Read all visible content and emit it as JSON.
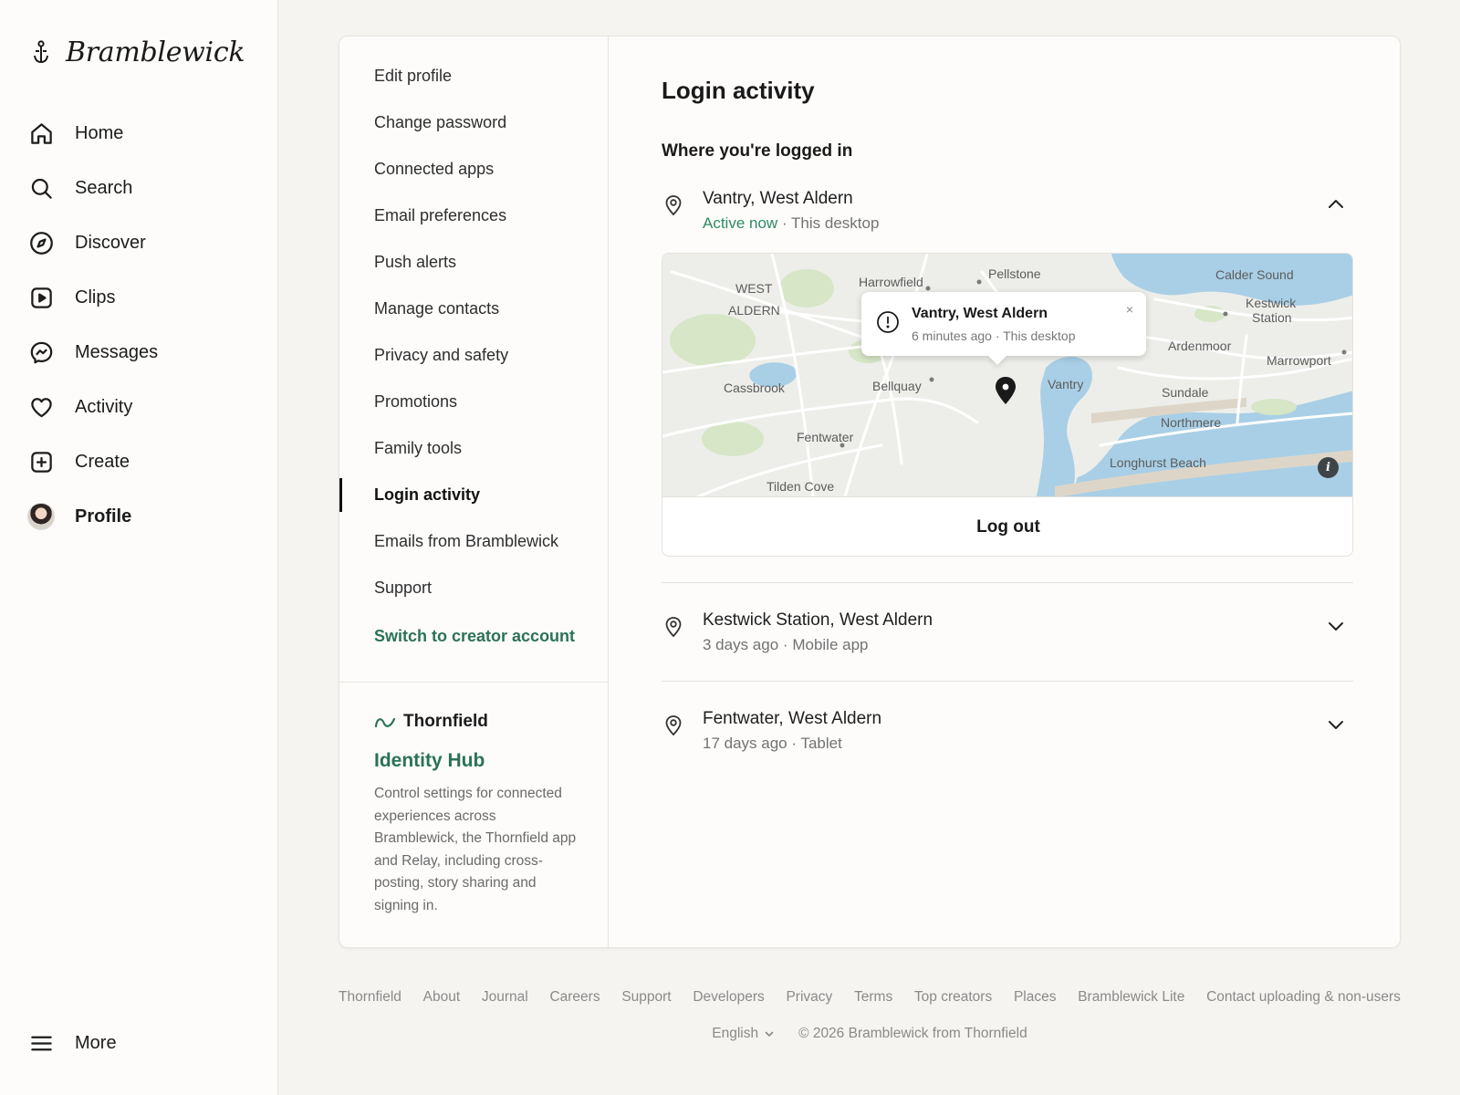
{
  "brand": {
    "name": "Bramblewick",
    "logo_icon": "anchor-icon"
  },
  "nav": {
    "items": [
      {
        "label": "Home",
        "icon": "home-icon"
      },
      {
        "label": "Search",
        "icon": "search-icon"
      },
      {
        "label": "Discover",
        "icon": "compass-icon"
      },
      {
        "label": "Clips",
        "icon": "play-icon"
      },
      {
        "label": "Messages",
        "icon": "messenger-icon"
      },
      {
        "label": "Activity",
        "icon": "heart-icon"
      },
      {
        "label": "Create",
        "icon": "plus-square-icon"
      },
      {
        "label": "Profile",
        "icon": "avatar"
      }
    ],
    "more_label": "More"
  },
  "settings": {
    "items": [
      "Edit profile",
      "Change password",
      "Connected apps",
      "Email preferences",
      "Push alerts",
      "Manage contacts",
      "Privacy and safety",
      "Promotions",
      "Family tools",
      "Login activity",
      "Emails from Bramblewick",
      "Support"
    ],
    "active": "Login activity",
    "creator_link": "Switch to creator account"
  },
  "hub": {
    "brand": "Thornfield",
    "title": "Identity Hub",
    "description": "Control settings for connected experiences across Bramblewick, the Thornfield app and Relay, including cross-posting, story sharing and signing in."
  },
  "login_activity": {
    "title": "Login activity",
    "subtitle": "Where you're logged in",
    "sessions": [
      {
        "location": "Vantry, West Aldern",
        "status": "Active now",
        "separator": "·",
        "device": "This desktop",
        "expanded": true
      },
      {
        "location": "Kestwick Station, West Aldern",
        "time": "3 days ago",
        "separator": "·",
        "device": "Mobile app",
        "expanded": false
      },
      {
        "location": "Fentwater, West Aldern",
        "time": "17 days ago",
        "separator": "·",
        "device": "Tablet",
        "expanded": false
      }
    ],
    "map": {
      "popup_title": "Vantry, West Aldern",
      "popup_meta": "6 minutes ago · This desktop",
      "close_glyph": "×",
      "info_glyph": "i",
      "labels": {
        "west": "WEST",
        "aldern": "ALDERN",
        "harrowfield": "Harrowfield",
        "pellstone": "Pellstone",
        "calder_sound": "Calder Sound",
        "kestwick": "Kestwick",
        "station": "Station",
        "ardenmoor": "Ardenmoor",
        "marrowport": "Marrowport",
        "cassbrook": "Cassbrook",
        "bellquay": "Bellquay",
        "vantry": "Vantry",
        "sundale": "Sundale",
        "northmere": "Northmere",
        "fentwater": "Fentwater",
        "longhurst_beach": "Longhurst Beach",
        "tilden_cove": "Tilden Cove"
      },
      "colors": {
        "water": "#a9cfe6",
        "land": "#edeeea",
        "park": "#d6e6c6",
        "road": "#ffffff",
        "sand": "#ddd6c8"
      }
    },
    "logout_label": "Log out"
  },
  "footer": {
    "links": [
      "Thornfield",
      "About",
      "Journal",
      "Careers",
      "Support",
      "Developers",
      "Privacy",
      "Terms",
      "Top creators",
      "Places",
      "Bramblewick Lite",
      "Contact uploading & non-users"
    ],
    "language": "English",
    "copyright": "© 2026 Bramblewick from Thornfield"
  },
  "colors": {
    "accent_green": "#2b7258",
    "active_green": "#2e8a63",
    "background": "#f5f4f1"
  }
}
